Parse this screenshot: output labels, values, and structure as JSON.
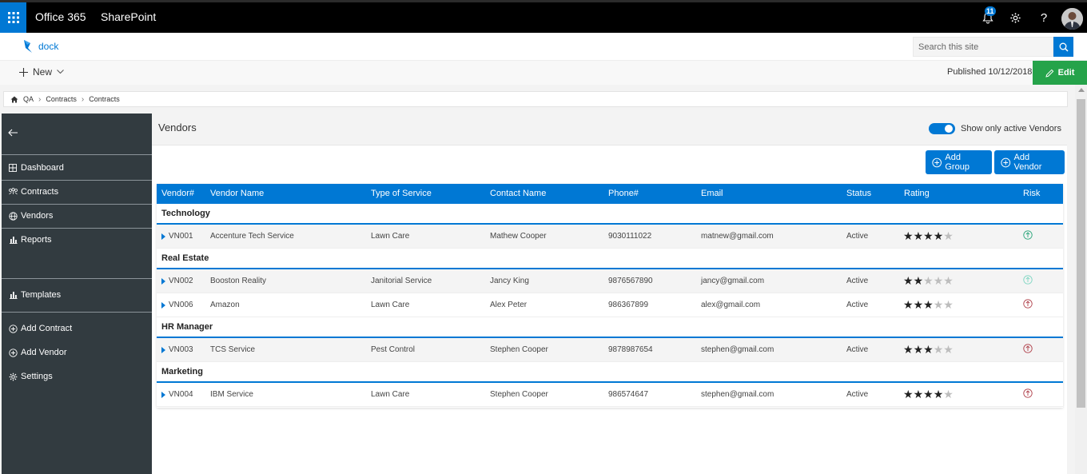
{
  "suite": {
    "app_name": "Office 365",
    "site_app": "SharePoint",
    "notification_count": "11",
    "help_label": "?"
  },
  "site": {
    "logo_text": "dock",
    "search_placeholder": "Search this site"
  },
  "command_bar": {
    "new_label": "New",
    "published": "Published 10/12/2018",
    "edit_label": "Edit"
  },
  "breadcrumb": [
    "QA",
    "Contracts",
    "Contracts"
  ],
  "leftnav": {
    "main": [
      {
        "label": "Dashboard",
        "icon": "grid-icon"
      },
      {
        "label": "Contracts",
        "icon": "org-icon"
      },
      {
        "label": "Vendors",
        "icon": "globe-icon"
      },
      {
        "label": "Reports",
        "icon": "bar-chart-icon"
      }
    ],
    "secondary": [
      {
        "label": "Templates",
        "icon": "bar-chart-icon"
      }
    ],
    "actions": [
      {
        "label": "Add Contract",
        "icon": "add-circle-icon"
      },
      {
        "label": "Add Vendor",
        "icon": "add-circle-icon"
      },
      {
        "label": "Settings",
        "icon": "gear-icon"
      }
    ]
  },
  "vendors": {
    "title": "Vendors",
    "toggle_label": "Show only active Vendors",
    "toggle_on": true,
    "add_group_label": "Add Group",
    "add_vendor_label": "Add Vendor"
  },
  "table": {
    "columns": [
      "Vendor#",
      "Vendor Name",
      "Type of Service",
      "Contact Name",
      "Phone#",
      "Email",
      "Status",
      "Rating",
      "Risk"
    ],
    "groups": [
      {
        "name": "Technology",
        "rows": [
          {
            "id": "VN001",
            "name": "Accenture Tech Service",
            "service": "Lawn Care",
            "contact": "Mathew Cooper",
            "phone": "9030111022",
            "email": "matnew@gmail.com",
            "status": "Active",
            "rating": 4,
            "risk": "low"
          }
        ]
      },
      {
        "name": "Real Estate",
        "rows": [
          {
            "id": "VN002",
            "name": "Booston Reality",
            "service": "Janitorial Service",
            "contact": "Jancy King",
            "phone": "9876567890",
            "email": "jancy@gmail.com",
            "status": "Active",
            "rating": 2,
            "risk": "low-faded"
          },
          {
            "id": "VN006",
            "name": "Amazon",
            "service": "Lawn Care",
            "contact": "Alex Peter",
            "phone": "986367899",
            "email": "alex@gmail.com",
            "status": "Active",
            "rating": 3,
            "risk": "high"
          }
        ]
      },
      {
        "name": "HR Manager",
        "rows": [
          {
            "id": "VN003",
            "name": "TCS Service",
            "service": "Pest Control",
            "contact": "Stephen Cooper",
            "phone": "9878987654",
            "email": "stephen@gmail.com",
            "status": "Active",
            "rating": 3,
            "risk": "high"
          }
        ]
      },
      {
        "name": "Marketing",
        "rows": [
          {
            "id": "VN004",
            "name": "IBM Service",
            "service": "Lawn Care",
            "contact": "Stephen Cooper",
            "phone": "986574647",
            "email": "stephen@gmail.com",
            "status": "Active",
            "rating": 4,
            "risk": "high"
          }
        ]
      }
    ]
  },
  "colors": {
    "accent": "#0078d4",
    "edit_green": "#25a34a",
    "nav_bg": "#323b40",
    "risk_low": "#2aa57a",
    "risk_low_faded": "#7fd6c2",
    "risk_high": "#b0404a"
  }
}
